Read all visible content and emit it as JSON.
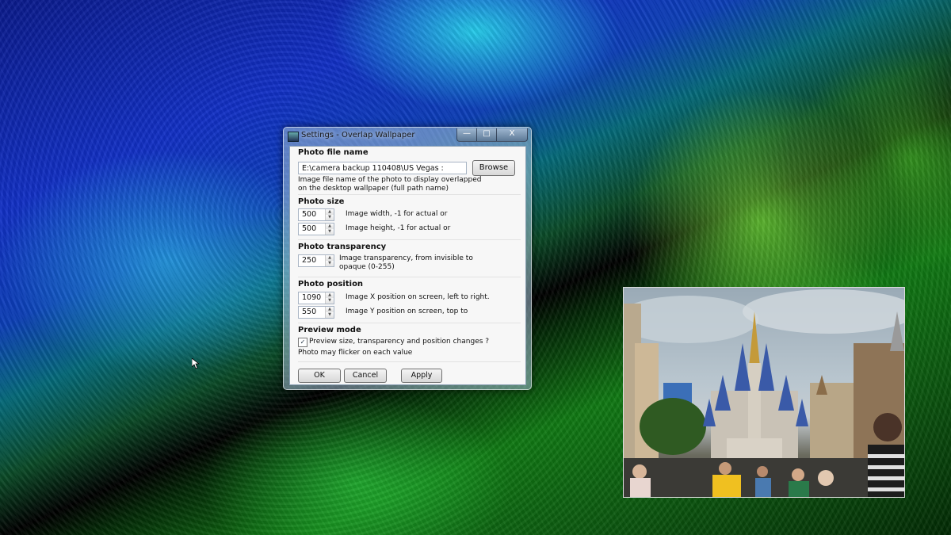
{
  "window": {
    "title": "Settings - Overlap Wallpaper",
    "minimize": "—",
    "maximize": "□",
    "close": "X"
  },
  "photo_file": {
    "heading": "Photo file name",
    "value": "E:\\camera backup 110408\\US Vegas :",
    "browse_label": "Browse",
    "desc_line1": "Image file name of the photo to display overlapped",
    "desc_line2": "on the desktop wallpaper (full path name)"
  },
  "photo_size": {
    "heading": "Photo size",
    "width_value": "500",
    "width_desc": "Image width, -1 for actual or",
    "height_value": "500",
    "height_desc": "Image height, -1 for actual or"
  },
  "photo_transparency": {
    "heading": "Photo transparency",
    "value": "250",
    "desc_line1": "Image transparency, from invisible to",
    "desc_line2": "opaque (0-255)"
  },
  "photo_position": {
    "heading": "Photo position",
    "x_value": "1090",
    "x_desc": "Image X position on screen, left to right.",
    "y_value": "550",
    "y_desc": "Image Y position on screen, top to"
  },
  "preview_mode": {
    "heading": "Preview mode",
    "checked": true,
    "check_glyph": "✓",
    "label": "Preview size, transparency and position changes ?",
    "note": "Photo may flicker on each value"
  },
  "buttons": {
    "ok": "OK",
    "cancel": "Cancel",
    "apply": "Apply"
  },
  "icons": {
    "spin_up": "▲",
    "spin_down": "▼"
  },
  "colors": {
    "window_frame": "#a0bed2",
    "client_bg": "#f7f7f7",
    "wallpaper_blue": "#1230c6",
    "wallpaper_green": "#117a14"
  }
}
